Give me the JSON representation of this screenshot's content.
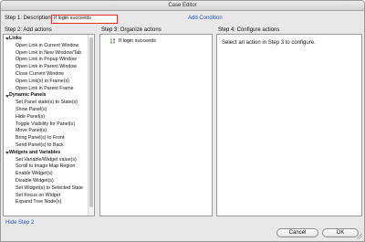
{
  "window": {
    "title": "Case Editor"
  },
  "step1": {
    "label": "Step 1: Description",
    "description_value": "If login succeeds",
    "add_condition_label": "Add Condition"
  },
  "step2": {
    "header": "Step 2: Add actions",
    "categories": [
      {
        "label": "Links",
        "items": [
          "Open Link in Current Window",
          "Open Link in New Window/Tab",
          "Open Link in Popup Window",
          "Open Link in Parent Window",
          "Close Current Window",
          "Open Link(s) in Frame(s)",
          "Open Link in Parent Frame"
        ]
      },
      {
        "label": "Dynamic Panels",
        "items": [
          "Set Panel state(s) to State(s)",
          "Show Panel(s)",
          "Hide Panel(s)",
          "Toggle Visibility for Panel(s)",
          "Move Panel(s)",
          "Bring Panel(s) to Front",
          "Send Panel(s) to Back"
        ]
      },
      {
        "label": "Widgets and Variables",
        "items": [
          "Set Variable/Widget value(s)",
          "Scroll to Image Map Region",
          "Enable Widget(s)",
          "Disable Widget(s)",
          "Set Widget(s) to Selected State",
          "Set Focus on Widget",
          "Expand Tree Node(s)"
        ]
      }
    ],
    "hide_label": "Hide Step 2"
  },
  "step3": {
    "header": "Step 3: Organize actions",
    "case_label": "If login succeeds"
  },
  "step4": {
    "header": "Step 4: Configure actions",
    "hint": "Select an action in Step 3 to configure."
  },
  "buttons": {
    "cancel": "Cancel",
    "ok": "OK"
  },
  "colors": {
    "link": "#2a56c6",
    "highlight_border": "#d9302a"
  }
}
